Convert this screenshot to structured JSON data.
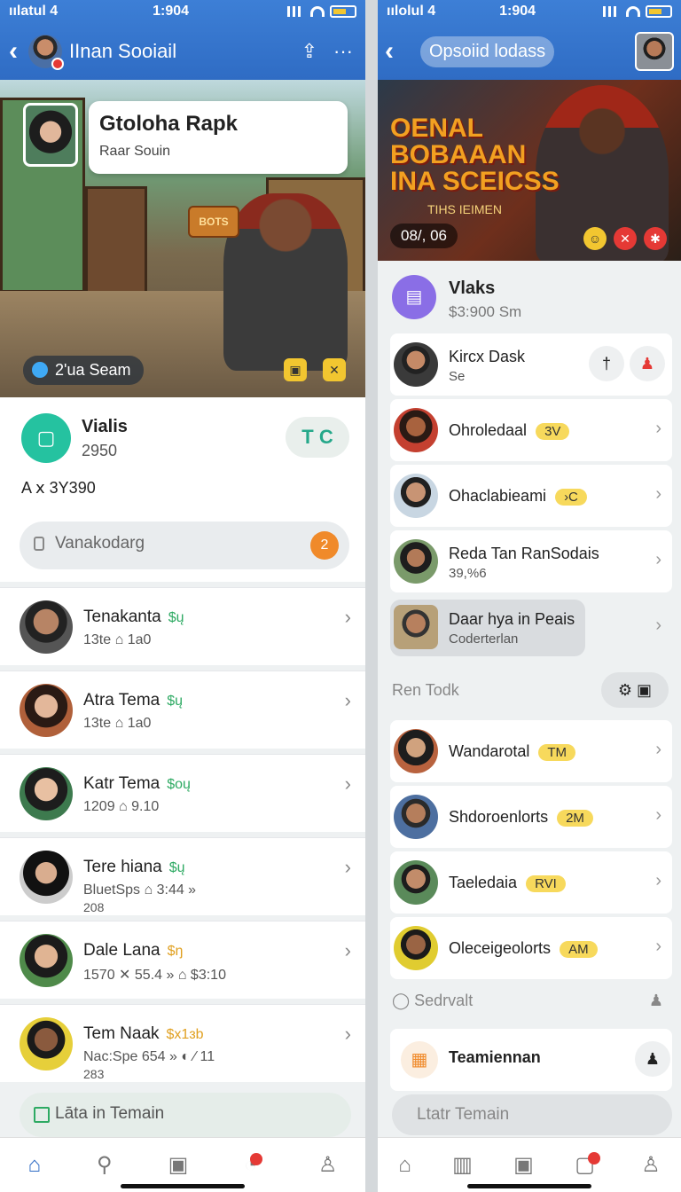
{
  "left": {
    "status": {
      "carrier": "ıılatul 4",
      "time": "1:904"
    },
    "nav": {
      "title": "IInan Sooiail",
      "share_icon": "share-icon",
      "more_icon": "more-icon"
    },
    "hero": {
      "card_title": "Gtoloha Rapk",
      "card_sub": "Raar Souin",
      "emblem": "BOTS",
      "pill": "2'ua Seam"
    },
    "group": {
      "name": "Vialis",
      "sub": "2950",
      "action": "T C",
      "meta": "A ⅹ 3Y390",
      "search_placeholder": "Vanakodarg",
      "search_badge": "2"
    },
    "rows": [
      {
        "name": "Tenakanta",
        "tag": "$ų",
        "sub": "13te  ⌂ 1a0"
      },
      {
        "name": "Atra Tema",
        "tag": "$ų",
        "sub": "13te  ⌂ 1a0"
      },
      {
        "name": "Katr Tema",
        "tag": "$oų",
        "sub": "1209  ⌂ 9.10"
      },
      {
        "name": "Tere hiana",
        "tag": "$ų",
        "sub": "BluetSps ⌂ 3:44 »"
      },
      {
        "name": "Dale Lana",
        "tag": "$ŋ",
        "sub": "1570 ✕ 55.4 »  ⌂ $3:10"
      },
      {
        "name": "Tem Naak",
        "tag": "$x1ɜb",
        "sub": "Nac:Spe  654 »  ◐ ⁄  11"
      }
    ],
    "row_extra": [
      "208",
      "283"
    ],
    "button": "Lāta in Temain"
  },
  "right": {
    "status": {
      "carrier": "ıılolul 4",
      "time": "1:904"
    },
    "nav": {
      "title": "Opsoiid lodass"
    },
    "hero": {
      "title_lines": [
        "OENAL",
        "BOBAAAN",
        "INA SCEICSS"
      ],
      "subtitle": "TIHS IEIMEN",
      "pill": "08/, 06"
    },
    "group": {
      "name": "Vlaks",
      "sub": "$3:900 Sm"
    },
    "rows": [
      {
        "name": "Kircx Dask",
        "sub": "Se"
      },
      {
        "name": "Ohroledaal",
        "pill": "3V"
      },
      {
        "name": "Ohaclabieami",
        "pill": "›C"
      },
      {
        "name": "Reda Tan RanSodais",
        "sub": "39,%6"
      },
      {
        "name": "Daar hya in Peais",
        "sub": "Coderterlan"
      }
    ],
    "section1": "Ren Todk",
    "rows2": [
      {
        "name": "Wandarotal",
        "pill": "TM"
      },
      {
        "name": "Shdoroenlorts",
        "pill": "2M"
      },
      {
        "name": "Taeledaia",
        "pill": "RVI"
      },
      {
        "name": "Oleceigeolorts",
        "pill": "AM"
      }
    ],
    "section2": "Sedrvalt",
    "team": "Teamiennan",
    "button": "Ltatr Temain"
  }
}
